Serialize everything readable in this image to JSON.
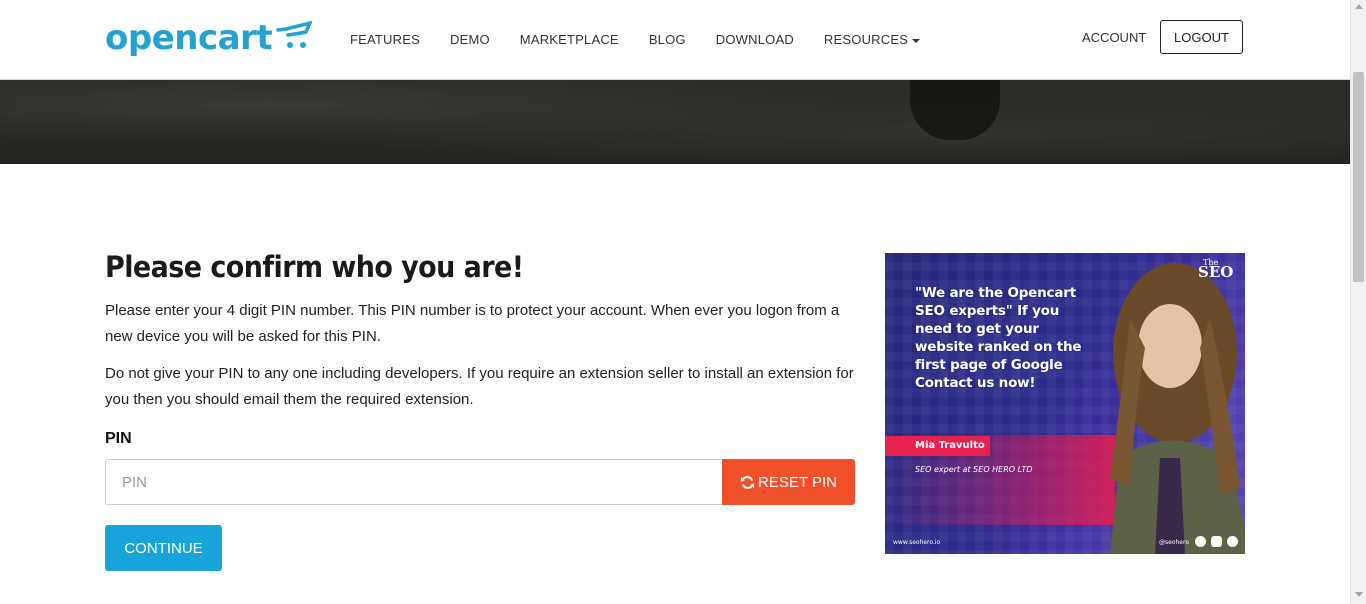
{
  "header": {
    "logo_text": "opencart",
    "nav": [
      {
        "label": "FEATURES"
      },
      {
        "label": "DEMO"
      },
      {
        "label": "MARKETPLACE"
      },
      {
        "label": "BLOG"
      },
      {
        "label": "DOWNLOAD"
      },
      {
        "label": "RESOURCES"
      }
    ],
    "account_label": "ACCOUNT",
    "logout_label": "LOGOUT"
  },
  "main": {
    "title": "Please confirm who you are!",
    "paragraph1": "Please enter your 4 digit PIN number. This PIN number is to protect your account. When ever you logon from a new device you will be asked for this PIN.",
    "paragraph2": "Do not give your PIN to any one including developers. If you require an extension seller to install an extension for you then you should email them the required extension.",
    "pin_label": "PIN",
    "pin_placeholder": "PIN",
    "pin_value": "",
    "reset_label": "RESET PIN",
    "continue_label": "CONTINUE"
  },
  "ad": {
    "logo_small": "The",
    "logo": "SEO",
    "quote": "\"We are the Opencart SEO experts\" If you need to get your website ranked on the first page of Google Contact us now!",
    "name": "Mia Travulto",
    "role": "SEO expert at SEO HERO LTD",
    "url": "www.seohero.io",
    "handle": "@seohero"
  },
  "colors": {
    "brand": "#23a1d1",
    "reset_button": "#f0512b",
    "continue_button": "#18a4d9",
    "ad_name_highlight": "#e8224e"
  },
  "icons": {
    "reset": "refresh-icon",
    "dropdown": "caret-down-icon",
    "social": [
      "facebook-icon",
      "instagram-icon",
      "twitter-icon"
    ]
  }
}
